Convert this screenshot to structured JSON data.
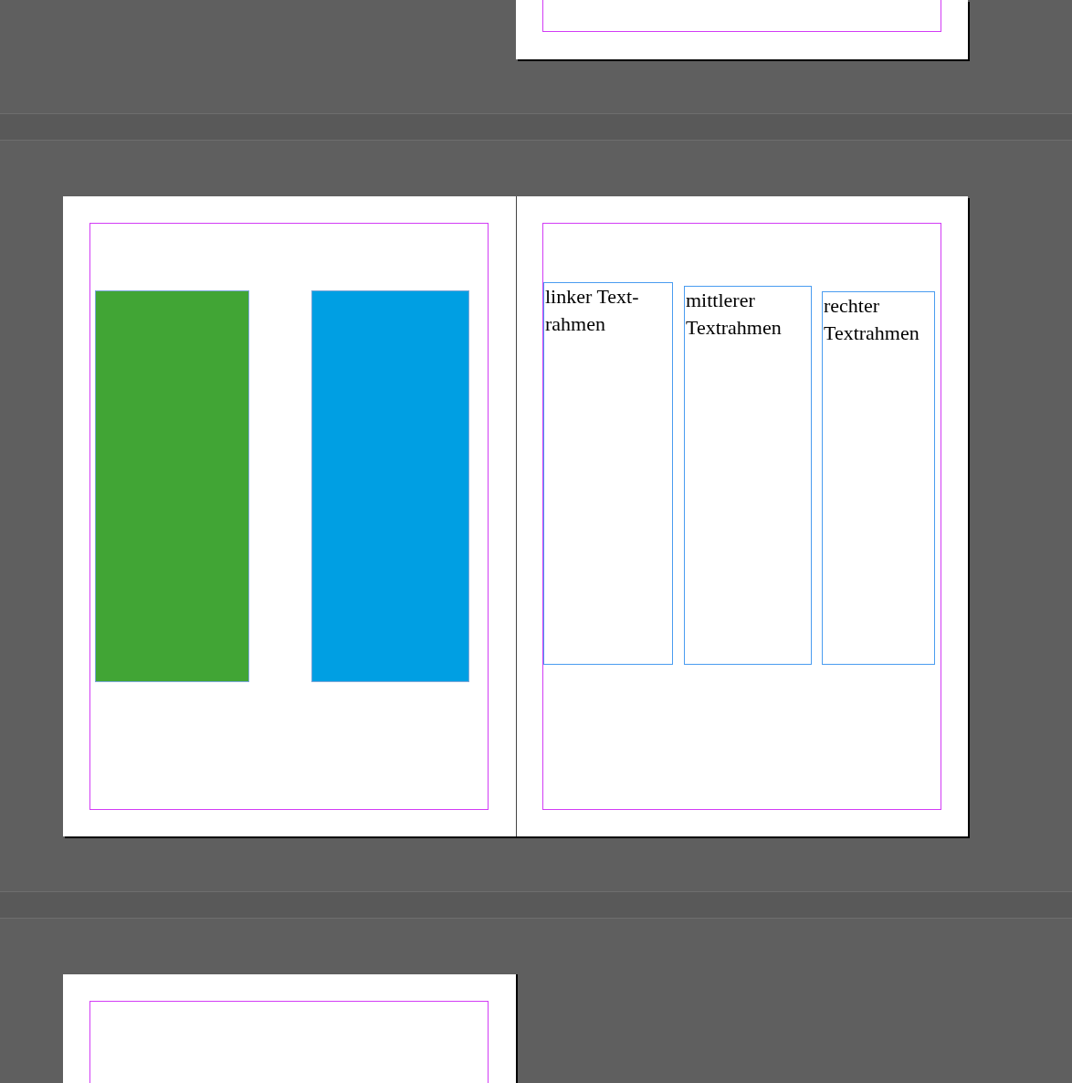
{
  "spread": {
    "left_page": {
      "shapes": [
        {
          "kind": "rectangle",
          "color": "#41a535"
        },
        {
          "kind": "rectangle",
          "color": "#009fe3"
        }
      ]
    },
    "right_page": {
      "text_frames": [
        {
          "text": "linker Text-\nrahmen"
        },
        {
          "text": "mittlerer\nTextrahmen"
        },
        {
          "text": "rechter\nTextrahmen"
        }
      ]
    }
  }
}
